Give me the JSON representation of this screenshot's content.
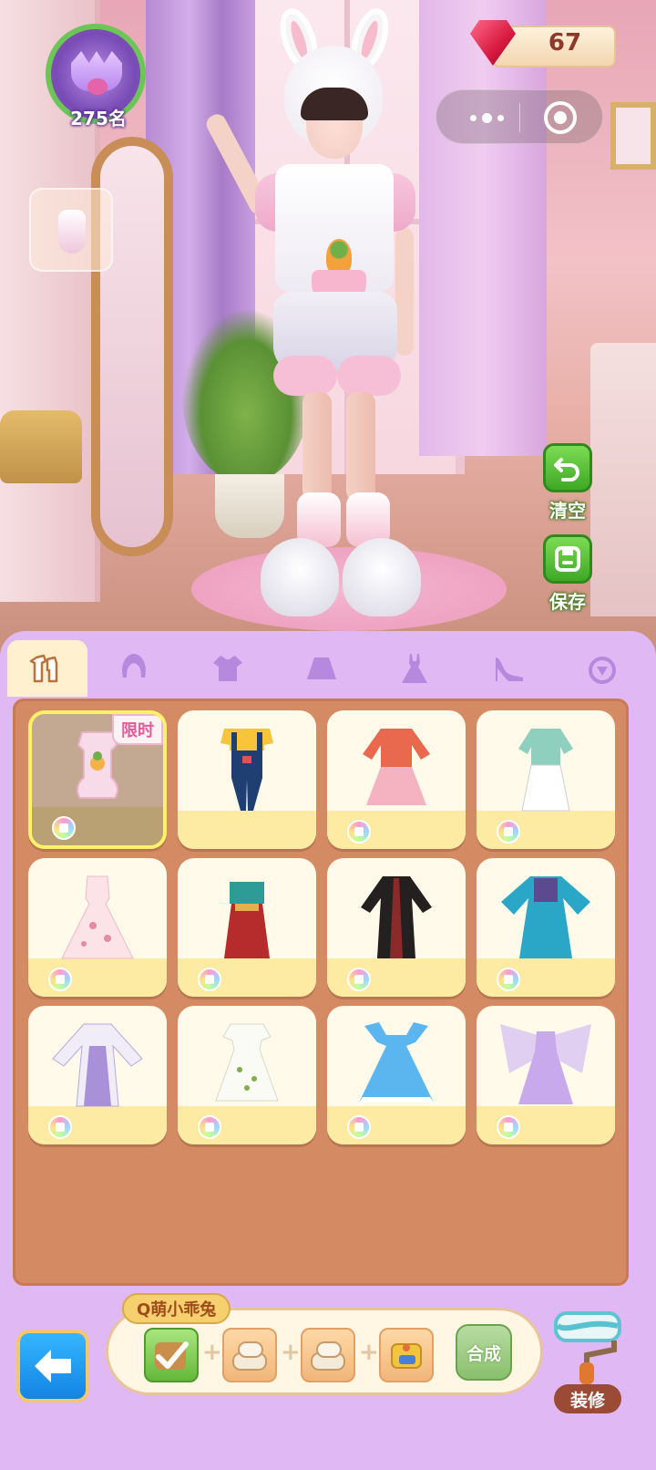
{
  "hud": {
    "rank_label": "275名",
    "gem_count": "67"
  },
  "side_actions": {
    "clear_label": "清空",
    "save_label": "保存"
  },
  "tabs": [
    {
      "icon": "outfit-set-icon",
      "active": true
    },
    {
      "icon": "hair-icon",
      "active": false
    },
    {
      "icon": "top-icon",
      "active": false
    },
    {
      "icon": "skirt-icon",
      "active": false
    },
    {
      "icon": "dress-icon",
      "active": false
    },
    {
      "icon": "shoes-icon",
      "active": false
    },
    {
      "icon": "accessory-icon",
      "active": false
    }
  ],
  "grid": {
    "items": [
      {
        "outfit": "pink-bunny-overalls",
        "badge": "限时",
        "selected": true
      },
      {
        "outfit": "denim-overalls",
        "badge": "",
        "selected": false
      },
      {
        "outfit": "pink-jacket-dress",
        "badge": "",
        "selected": false
      },
      {
        "outfit": "mint-qipao-set",
        "badge": "",
        "selected": false
      },
      {
        "outfit": "pink-floral-gown",
        "badge": "",
        "selected": false
      },
      {
        "outfit": "teal-red-hanfu",
        "badge": "",
        "selected": false
      },
      {
        "outfit": "black-robe",
        "badge": "",
        "selected": false
      },
      {
        "outfit": "blue-hanfu",
        "badge": "",
        "selected": false
      },
      {
        "outfit": "lavender-hanfu",
        "badge": "",
        "selected": false
      },
      {
        "outfit": "white-floral-dress",
        "badge": "",
        "selected": false
      },
      {
        "outfit": "blue-princess-gown",
        "badge": "",
        "selected": false
      },
      {
        "outfit": "fairy-wing-gown",
        "badge": "",
        "selected": false
      }
    ]
  },
  "recipe": {
    "name": "Q萌小乖兔",
    "craft_label": "合成",
    "slots": [
      "outfit-set",
      "fabric-roll",
      "fabric-roll",
      "sewing-kit"
    ]
  },
  "decorate": {
    "label": "装修"
  },
  "colors": {
    "panel": "#e0b8f4",
    "grid_bg": "#d48a63",
    "card_foot": "#fdeaa3",
    "accent_green": "#3ea825",
    "back_blue": "#1384e3"
  }
}
